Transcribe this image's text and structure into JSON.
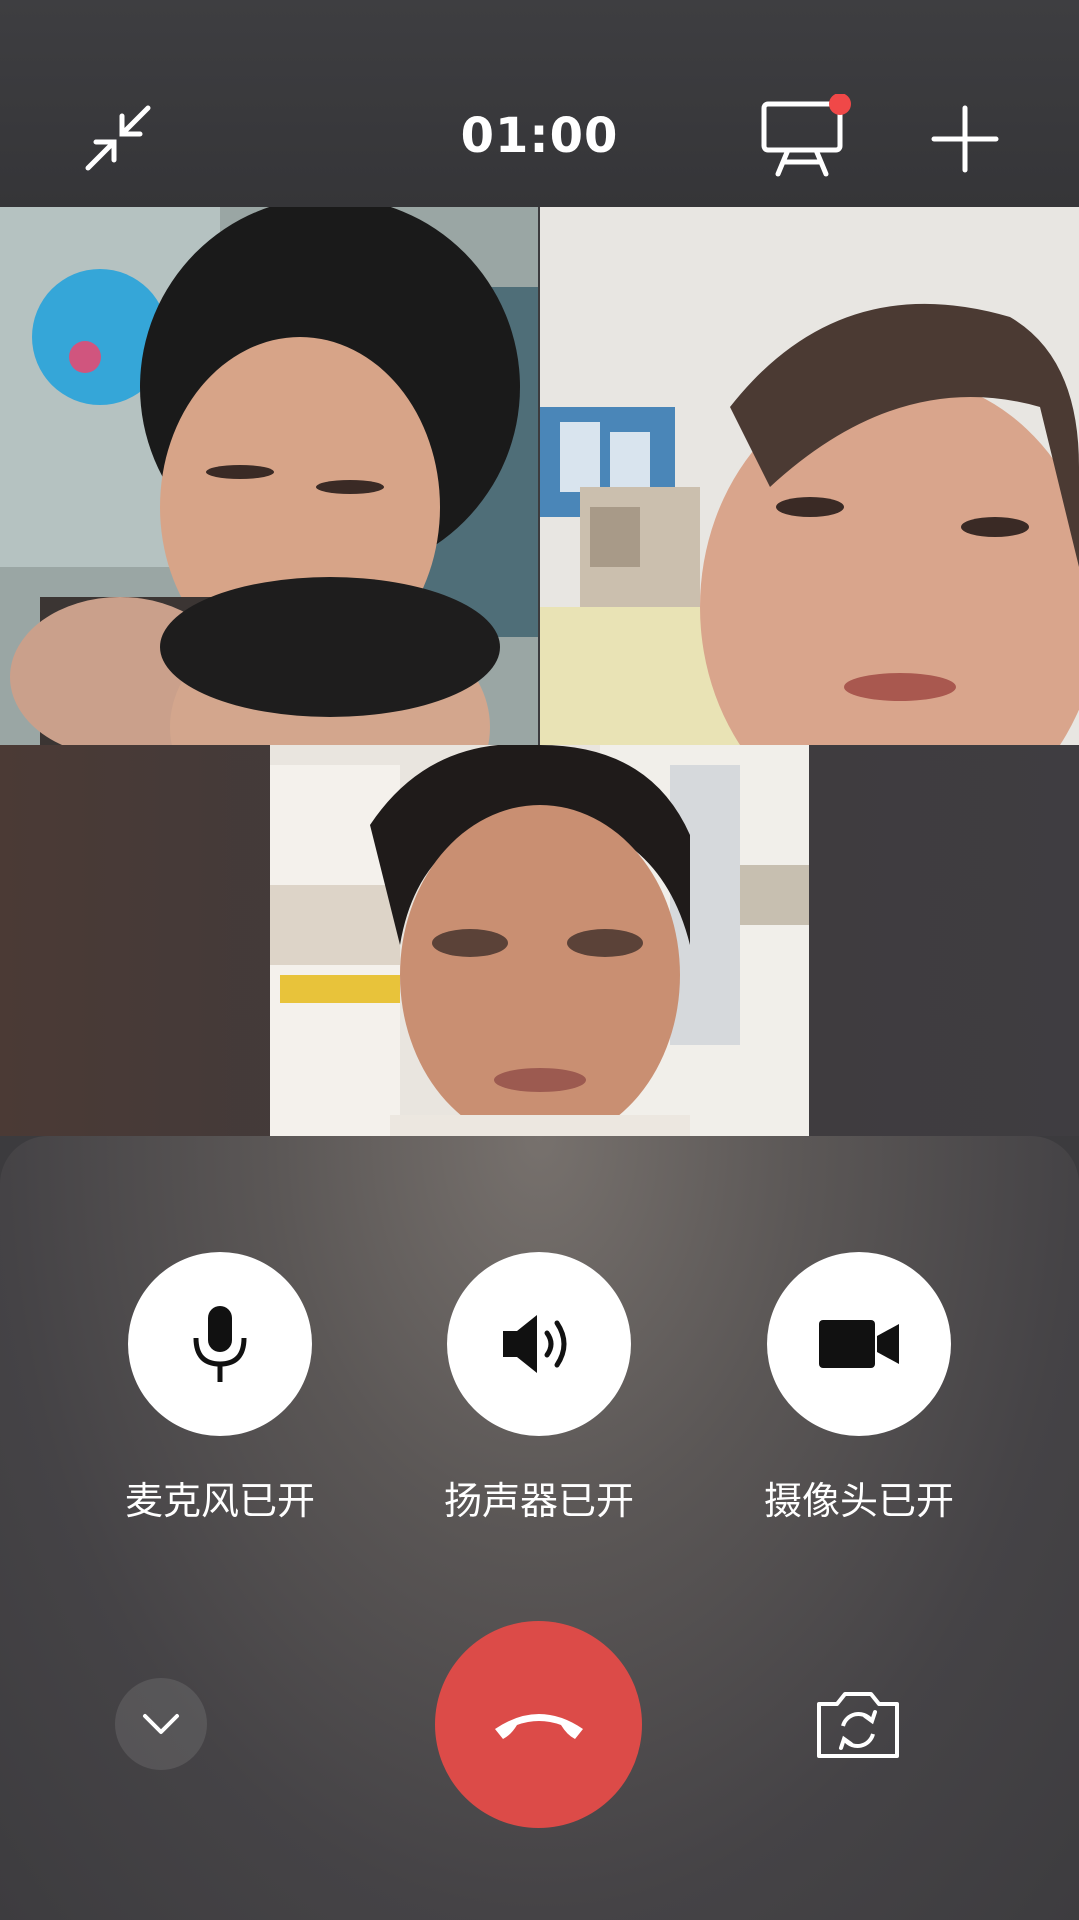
{
  "header": {
    "timer": "01:00",
    "minimize_icon": "minimize-arrows-icon",
    "screen_share_icon": "presentation-board-icon",
    "add_icon": "plus-icon",
    "notification_dot_color": "#f04848"
  },
  "participants": [
    {
      "name_hidden": true
    },
    {
      "name_hidden": true
    },
    {
      "name_hidden": true
    }
  ],
  "controls": {
    "mic_label": "麦克风已开",
    "speaker_label": "扬声器已开",
    "camera_label": "摄像头已开"
  },
  "bottom": {
    "collapse_icon": "chevron-down-icon",
    "hangup_icon": "phone-hangup-icon",
    "hangup_color": "#dc4b48",
    "flip_camera_icon": "camera-flip-icon"
  }
}
